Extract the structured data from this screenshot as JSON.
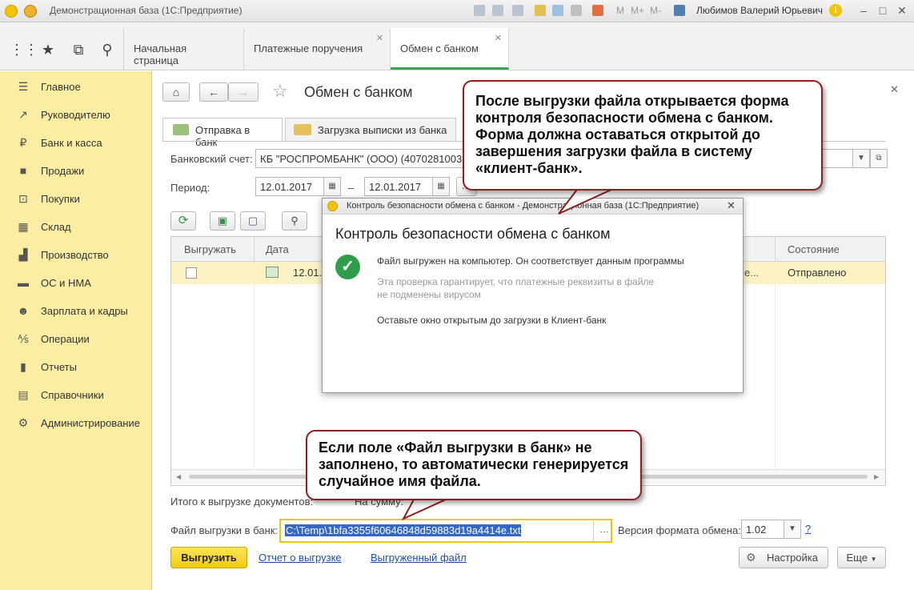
{
  "titlebar": {
    "title": "Демонстрационная база  (1С:Предприятие)",
    "m_plus": "M",
    "m_plus2": "M+",
    "m_minus": "M-",
    "user": "Любимов Валерий Юрьевич",
    "info": "i"
  },
  "tabs": [
    {
      "label": "Начальная страница"
    },
    {
      "label": "Платежные поручения"
    },
    {
      "label": "Обмен с банком"
    }
  ],
  "sidebar": {
    "items": [
      {
        "label": "Главное",
        "icon": "menu-icon"
      },
      {
        "label": "Руководителю",
        "icon": "chart-line-icon"
      },
      {
        "label": "Банк и касса",
        "icon": "ruble-icon"
      },
      {
        "label": "Продажи",
        "icon": "bag-icon"
      },
      {
        "label": "Покупки",
        "icon": "cart-icon"
      },
      {
        "label": "Склад",
        "icon": "warehouse-icon"
      },
      {
        "label": "Производство",
        "icon": "factory-icon"
      },
      {
        "label": "ОС и НМА",
        "icon": "truck-icon"
      },
      {
        "label": "Зарплата и кадры",
        "icon": "people-icon"
      },
      {
        "label": "Операции",
        "icon": "operations-icon"
      },
      {
        "label": "Отчеты",
        "icon": "bar-chart-icon"
      },
      {
        "label": "Справочники",
        "icon": "book-icon"
      },
      {
        "label": "Администрирование",
        "icon": "gear-icon"
      }
    ]
  },
  "form": {
    "title": "Обмен с банком",
    "subtabs": [
      "Отправка в банк",
      "Загрузка выписки из банка"
    ],
    "bank_account_label": "Банковский счет:",
    "bank_account_value": "КБ \"РОСПРОМБАНК\" (ООО) (40702810030",
    "period_label": "Период:",
    "period_from": "12.01.2017",
    "period_dash": "–",
    "period_to": "12.01.2017",
    "grid": {
      "columns": [
        "Выгружать",
        "Дата",
        "Состояние"
      ],
      "row": {
        "date": "12.01.",
        "ellipsis": "е...",
        "state": "Отправлено"
      }
    },
    "totals_label": "Итого к выгрузке документов:",
    "totals_sum_label": "На сумму:",
    "file_label": "Файл выгрузки в банк:",
    "file_value": "C:\\Temp\\1bfa3355f60646848d59883d19a4414e.txt",
    "format_label": "Версия формата обмена:",
    "format_value": "1.02",
    "help": "?",
    "export_button": "Выгрузить",
    "report_link": "Отчет о выгрузке",
    "exported_file_link": "Выгруженный файл",
    "settings_button": "Настройка",
    "more_button": "Еще"
  },
  "dialog": {
    "title": "Контроль безопасности обмена с банком - Демонстрационная база  (1С:Предприятие)",
    "heading": "Контроль безопасности обмена с банком",
    "msg1": "Файл выгружен на компьютер. Он соответствует данным программы",
    "msg2_line1": "Эта проверка гарантирует, что платежные реквизиты в файле",
    "msg2_line2": "не подменены вирусом",
    "msg3": "Оставьте окно открытым до загрузки в Клиент-банк"
  },
  "callouts": {
    "top": "После выгрузки файла открывается форма контроля безопасности обмена с банком. Форма должна оставаться открытой до завершения загрузки файла в систему «клиент-банк».",
    "bottom": "Если поле «Файл выгрузки в банк» не заполнено, то автоматически генерируется случайное имя файла."
  },
  "colors": {
    "sidebar_bg": "#fbeda1",
    "accent_green": "#3ca35a",
    "export_button": "#f7d51d",
    "callout_border": "#8a2020",
    "link": "#1a4fa8"
  }
}
